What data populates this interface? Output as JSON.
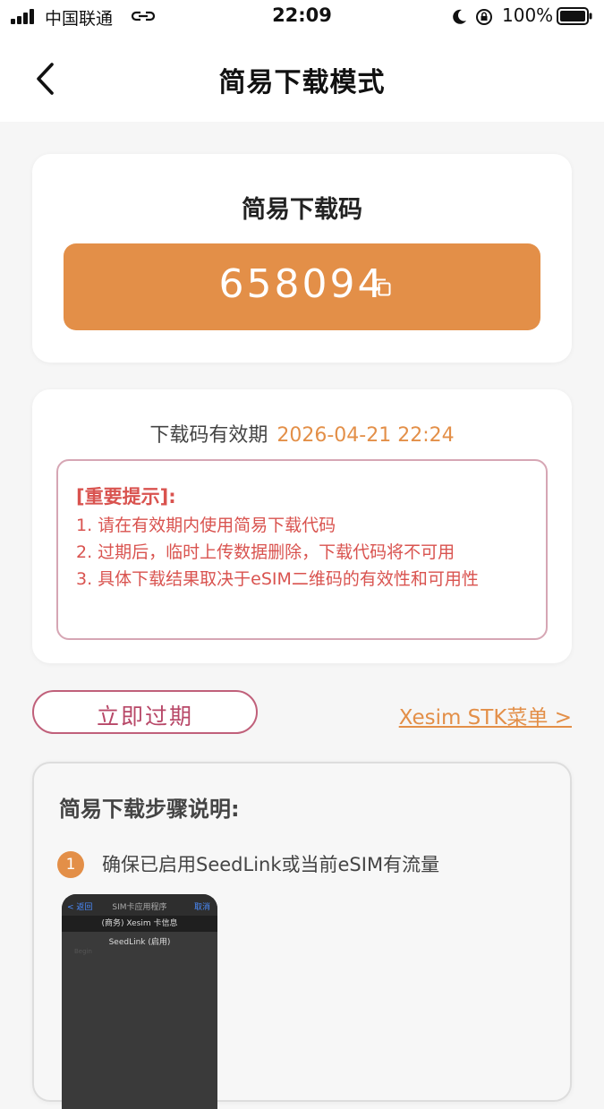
{
  "status_bar": {
    "carrier": "中国联通",
    "time": "22:09",
    "battery": "100%"
  },
  "nav": {
    "title": "简易下载模式"
  },
  "code_card": {
    "label": "简易下载码",
    "code": "658094"
  },
  "validity": {
    "label": "下载码有效期",
    "value": "2026-04-21 22:24"
  },
  "notice": {
    "title": "[重要提示]:",
    "lines": [
      "1. 请在有效期内使用简易下载代码",
      "2. 过期后，临时上传数据删除，下载代码将不可用",
      "3. 具体下载结果取决于eSIM二维码的有效性和可用性"
    ]
  },
  "actions": {
    "expire_label": "立即过期",
    "stk_link": "Xesim STK菜单 >"
  },
  "steps": {
    "title": "简易下载步骤说明:",
    "items": [
      {
        "number": "1",
        "text": "确保已启用SeedLink或当前eSIM有流量"
      }
    ]
  },
  "phone_preview": {
    "back": "< 返回",
    "title": "SIM卡应用程序",
    "cancel": "取消",
    "row1": "(商务) Xesim 卡信息",
    "row2": "SeedLink (启用)",
    "row3": "Begin"
  },
  "colors": {
    "accent": "#e38f48",
    "warning": "#d9534f",
    "expire_border": "#c0607a"
  }
}
